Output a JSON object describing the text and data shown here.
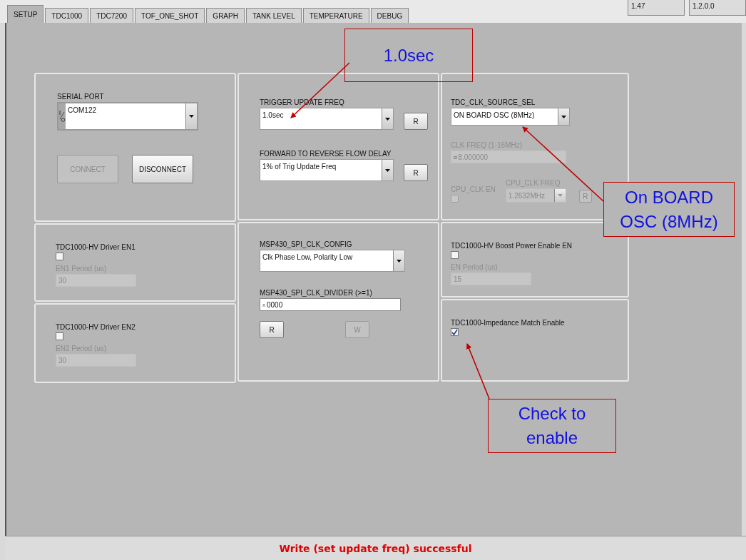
{
  "tabs": [
    {
      "label": "SETUP",
      "selected": true
    },
    {
      "label": "TDC1000",
      "selected": false
    },
    {
      "label": "TDC7200",
      "selected": false
    },
    {
      "label": "TOF_ONE_SHOT",
      "selected": false
    },
    {
      "label": "GRAPH",
      "selected": false
    },
    {
      "label": "TANK LEVEL",
      "selected": false
    },
    {
      "label": "TEMPERATURE",
      "selected": false
    },
    {
      "label": "DEBUG",
      "selected": false
    }
  ],
  "version_fields": [
    "1.47",
    "1.2.0.0"
  ],
  "columns": [
    {
      "panels": [
        {
          "controls": [
            {
              "kind": "io-dropdown",
              "label": "SERIAL PORT",
              "value": "COM122"
            },
            {
              "kind": "row",
              "items": [
                {
                  "kind": "button",
                  "label": "CONNECT",
                  "disabled": true
                },
                {
                  "kind": "button",
                  "label": "DISCONNECT",
                  "disabled": false
                }
              ]
            }
          ]
        },
        {
          "controls": [
            {
              "kind": "checkbox",
              "label": "TDC1000-HV Driver EN1",
              "checked": false,
              "disabled": false
            },
            {
              "kind": "numeric",
              "label": "EN1 Period (us)",
              "value": "30",
              "disabled": true
            }
          ]
        },
        {
          "controls": [
            {
              "kind": "checkbox",
              "label": "TDC1000-HV Driver EN2",
              "checked": false,
              "disabled": false
            },
            {
              "kind": "numeric",
              "label": "EN2 Period (us)",
              "value": "30",
              "disabled": true
            }
          ]
        }
      ]
    },
    {
      "panels": [
        {
          "controls": [
            {
              "kind": "row",
              "items": [
                {
                  "kind": "dropdown",
                  "label": "TRIGGER UPDATE FREQ",
                  "value": "1.0sec",
                  "disabled": false
                },
                {
                  "kind": "button",
                  "label": "R",
                  "disabled": false
                }
              ]
            },
            {
              "kind": "row",
              "items": [
                {
                  "kind": "dropdown",
                  "label": "FORWARD TO REVERSE FLOW DELAY",
                  "value": "1% of Trig Update Freq",
                  "disabled": false
                },
                {
                  "kind": "button",
                  "label": "R",
                  "disabled": false
                }
              ]
            }
          ]
        },
        {
          "controls": [
            {
              "kind": "dropdown",
              "label": "MSP430_SPI_CLK_CONFIG",
              "value": "Clk Phase Low, Polarity Low",
              "disabled": false
            },
            {
              "kind": "numeric",
              "label": "MSP430_SPI_CLK_DIVIDER (>=1)",
              "radix": "x",
              "value": "0000",
              "disabled": false
            },
            {
              "kind": "row",
              "items": [
                {
                  "kind": "button",
                  "label": "R",
                  "disabled": false
                },
                {
                  "kind": "button",
                  "label": "W",
                  "disabled": true
                }
              ]
            }
          ]
        }
      ]
    },
    {
      "panels": [
        {
          "controls": [
            {
              "kind": "dropdown",
              "label": "TDC_CLK_SOURCE_SEL",
              "value": "ON BOARD OSC (8MHz)",
              "disabled": false
            },
            {
              "kind": "numeric",
              "label": "CLK FREQ (1-16MHz)",
              "radix": "d",
              "value": "8.000000",
              "disabled": true
            },
            {
              "kind": "row",
              "items": [
                {
                  "kind": "checkbox",
                  "label": "CPU_CLK EN",
                  "checked": false,
                  "disabled": true
                },
                {
                  "kind": "dropdown",
                  "label": "CPU_CLK FREQ",
                  "value": "1.2632MHz",
                  "disabled": true
                },
                {
                  "kind": "button",
                  "label": "R",
                  "disabled": true
                }
              ]
            }
          ]
        },
        {
          "controls": [
            {
              "kind": "checkbox",
              "label": "TDC1000-HV Boost Power Enable EN",
              "checked": false,
              "disabled": false
            },
            {
              "kind": "numeric",
              "label": "EN Period (us)",
              "value": "15",
              "disabled": true
            }
          ]
        },
        {
          "controls": [
            {
              "kind": "checkbox",
              "label": "TDC1000-Impedance Match Enable",
              "checked": true,
              "disabled": false
            }
          ]
        }
      ]
    }
  ],
  "callouts": [
    {
      "text": "1.0sec"
    },
    {
      "text": "On BOARD OSC (8MHz)"
    },
    {
      "text": "Check to enable"
    }
  ],
  "status_bar": {
    "message": "Write (set update freq) successful"
  }
}
